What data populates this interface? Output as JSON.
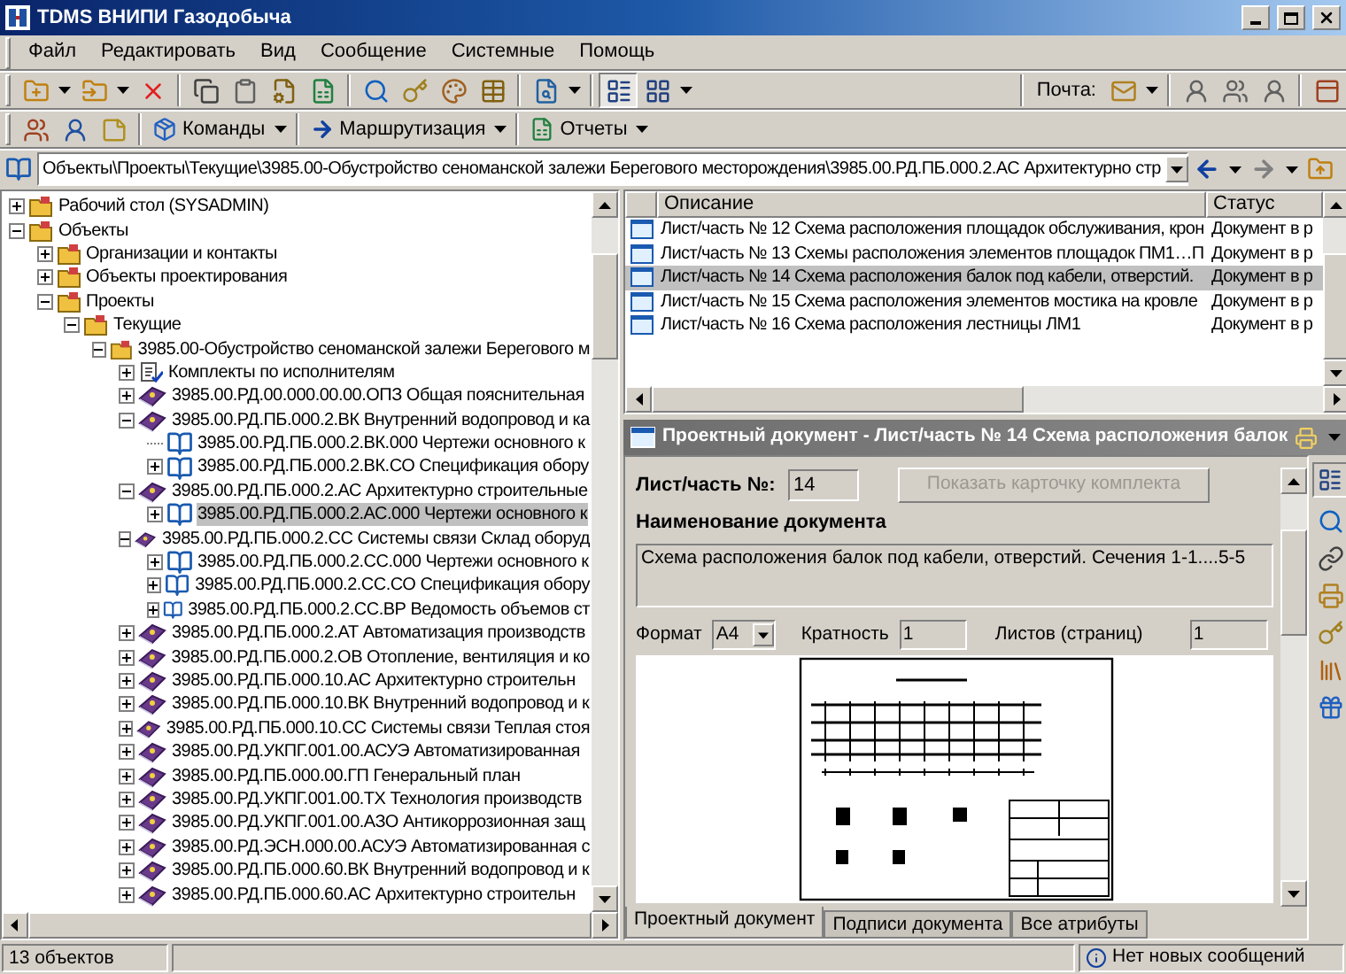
{
  "window": {
    "title": "TDMS ВНИПИ Газодобыча"
  },
  "menu": [
    "Файл",
    "Редактировать",
    "Вид",
    "Сообщение",
    "Системные",
    "Помощь"
  ],
  "mail": {
    "label": "Почта:"
  },
  "toolbar2": [
    {
      "label": "Команды",
      "kind": "commands"
    },
    {
      "label": "Маршрутизация",
      "kind": "routing"
    },
    {
      "label": "Отчеты",
      "kind": "reports"
    }
  ],
  "address": {
    "value": "Объекты\\Проекты\\Текущие\\3985.00-Обустройство сеноманской залежи Берегового месторождения\\3985.00.РД.ПБ.000.2.АС Архитектурно стр"
  },
  "tree": [
    {
      "label": "Рабочий стол (SYSADMIN)",
      "kind": "folder",
      "expanded": false,
      "selected": false
    },
    {
      "label": "Объекты",
      "kind": "folder",
      "expanded": true,
      "selected": false,
      "children": [
        {
          "label": "Организации и контакты",
          "kind": "folder",
          "expanded": false,
          "selected": false
        },
        {
          "label": "Объекты проектирования",
          "kind": "folder",
          "expanded": false,
          "selected": false
        },
        {
          "label": "Проекты",
          "kind": "folder",
          "expanded": true,
          "selected": false,
          "children": [
            {
              "label": "Текущие",
              "kind": "folder",
              "expanded": true,
              "selected": false,
              "children": [
                {
                  "label": "3985.00-Обустройство сеноманской залежи Берегового м",
                  "kind": "folder",
                  "expanded": true,
                  "selected": false,
                  "children": [
                    {
                      "label": "Комплекты по исполнителям",
                      "kind": "sets",
                      "expanded": false,
                      "selected": false
                    },
                    {
                      "label": "3985.00.РД.00.000.00.00.ОПЗ  Общая пояснительная",
                      "kind": "volume",
                      "expanded": false,
                      "selected": false
                    },
                    {
                      "label": "3985.00.РД.ПБ.000.2.ВК Внутренний водопровод и ка",
                      "kind": "volume",
                      "expanded": true,
                      "selected": false,
                      "children": [
                        {
                          "label": "3985.00.РД.ПБ.000.2.ВК.000 Чертежи основного к",
                          "kind": "part",
                          "selected": false
                        },
                        {
                          "label": "3985.00.РД.ПБ.000.2.ВК.СО Спецификация обору",
                          "kind": "part",
                          "expanded": false,
                          "selected": false
                        }
                      ]
                    },
                    {
                      "label": "3985.00.РД.ПБ.000.2.АС Архитектурно строительные",
                      "kind": "volume",
                      "expanded": true,
                      "selected": false,
                      "children": [
                        {
                          "label": "3985.00.РД.ПБ.000.2.АС.000 Чертежи основного к",
                          "kind": "part",
                          "expanded": false,
                          "selected": true
                        }
                      ]
                    },
                    {
                      "label": "3985.00.РД.ПБ.000.2.СС Системы связи Склад оборуд",
                      "kind": "volume",
                      "expanded": true,
                      "selected": false,
                      "children": [
                        {
                          "label": "3985.00.РД.ПБ.000.2.СС.000 Чертежи основного к",
                          "kind": "part",
                          "expanded": false,
                          "selected": false
                        },
                        {
                          "label": "3985.00.РД.ПБ.000.2.СС.СО Спецификация обору",
                          "kind": "part",
                          "expanded": false,
                          "selected": false
                        },
                        {
                          "label": "3985.00.РД.ПБ.000.2.СС.ВР Ведомость объемов ст",
                          "kind": "part",
                          "expanded": false,
                          "selected": false
                        }
                      ]
                    },
                    {
                      "label": "3985.00.РД.ПБ.000.2.АТ Автоматизация производств",
                      "kind": "volume",
                      "expanded": false,
                      "selected": false
                    },
                    {
                      "label": "3985.00.РД.ПБ.000.2.ОВ Отопление, вентиляция и ко",
                      "kind": "volume",
                      "expanded": false,
                      "selected": false
                    },
                    {
                      "label": "3985.00.РД.ПБ.000.10.АС Архитектурно строительн",
                      "kind": "volume",
                      "expanded": false,
                      "selected": false
                    },
                    {
                      "label": "3985.00.РД.ПБ.000.10.ВК Внутренний водопровод и к",
                      "kind": "volume",
                      "expanded": false,
                      "selected": false
                    },
                    {
                      "label": "3985.00.РД.ПБ.000.10.СС Системы связи Теплая стоя",
                      "kind": "volume",
                      "expanded": false,
                      "selected": false
                    },
                    {
                      "label": "3985.00.РД.УКПГ.001.00.АСУЭ Автоматизированная",
                      "kind": "volume",
                      "expanded": false,
                      "selected": false
                    },
                    {
                      "label": "3985.00.РД.ПБ.000.00.ГП Генеральный план",
                      "kind": "volume",
                      "expanded": false,
                      "selected": false
                    },
                    {
                      "label": "3985.00.РД.УКПГ.001.00.ТХ Технология производств",
                      "kind": "volume",
                      "expanded": false,
                      "selected": false
                    },
                    {
                      "label": "3985.00.РД.УКПГ.001.00.АЗО Антикоррозионная защ",
                      "kind": "volume",
                      "expanded": false,
                      "selected": false
                    },
                    {
                      "label": "3985.00.РД.ЭСН.000.00.АСУЭ Автоматизированная с",
                      "kind": "volume",
                      "expanded": false,
                      "selected": false
                    },
                    {
                      "label": "3985.00.РД.ПБ.000.60.ВК Внутренний водопровод и к",
                      "kind": "volume",
                      "expanded": false,
                      "selected": false
                    },
                    {
                      "label": "3985.00.РД.ПБ.000.60.АС Архитектурно строительн",
                      "kind": "volume",
                      "expanded": false,
                      "selected": false
                    }
                  ]
                }
              ]
            }
          ]
        }
      ]
    }
  ],
  "list": {
    "columns": [
      "Описание",
      "Статус"
    ],
    "rows": [
      {
        "description": "Лист/часть № 12 Схема расположения площадок обслуживания, крон",
        "status": "Документ в р",
        "selected": false
      },
      {
        "description": "Лист/часть № 13 Схемы расположения элементов площадок ПМ1…П",
        "status": "Документ в р",
        "selected": false
      },
      {
        "description": "Лист/часть № 14 Схема расположения балок под кабели, отверстий.",
        "status": "Документ в р",
        "selected": true
      },
      {
        "description": "Лист/часть № 15 Схема расположения элементов мостика на кровле",
        "status": "Документ в р",
        "selected": false
      },
      {
        "description": "Лист/часть № 16 Схема расположения лестницы ЛМ1",
        "status": "Документ в р",
        "selected": false
      }
    ]
  },
  "document": {
    "header": "Проектный документ - Лист/часть № 14 Схема расположения балок",
    "number_label": "Лист/часть №:",
    "number": "14",
    "kit_button": {
      "label": "Показать карточку комплекта",
      "disabled": true
    },
    "name_label": "Наименование документа",
    "name": "Схема расположения балок под кабели, отверстий. Сечения 1-1....5-5",
    "format_label": "Формат",
    "format": "A4",
    "multiplicity_label": "Кратность",
    "multiplicity": "1",
    "sheets_label": "Листов (страниц)",
    "sheets": "1",
    "tabs": [
      {
        "label": "Проектный документ",
        "selected": true
      },
      {
        "label": "Подписи документа",
        "selected": false
      },
      {
        "label": "Все атрибуты",
        "selected": false
      }
    ]
  },
  "status_bar": {
    "count": "13 объектов",
    "messages": "Нет новых сообщений"
  }
}
